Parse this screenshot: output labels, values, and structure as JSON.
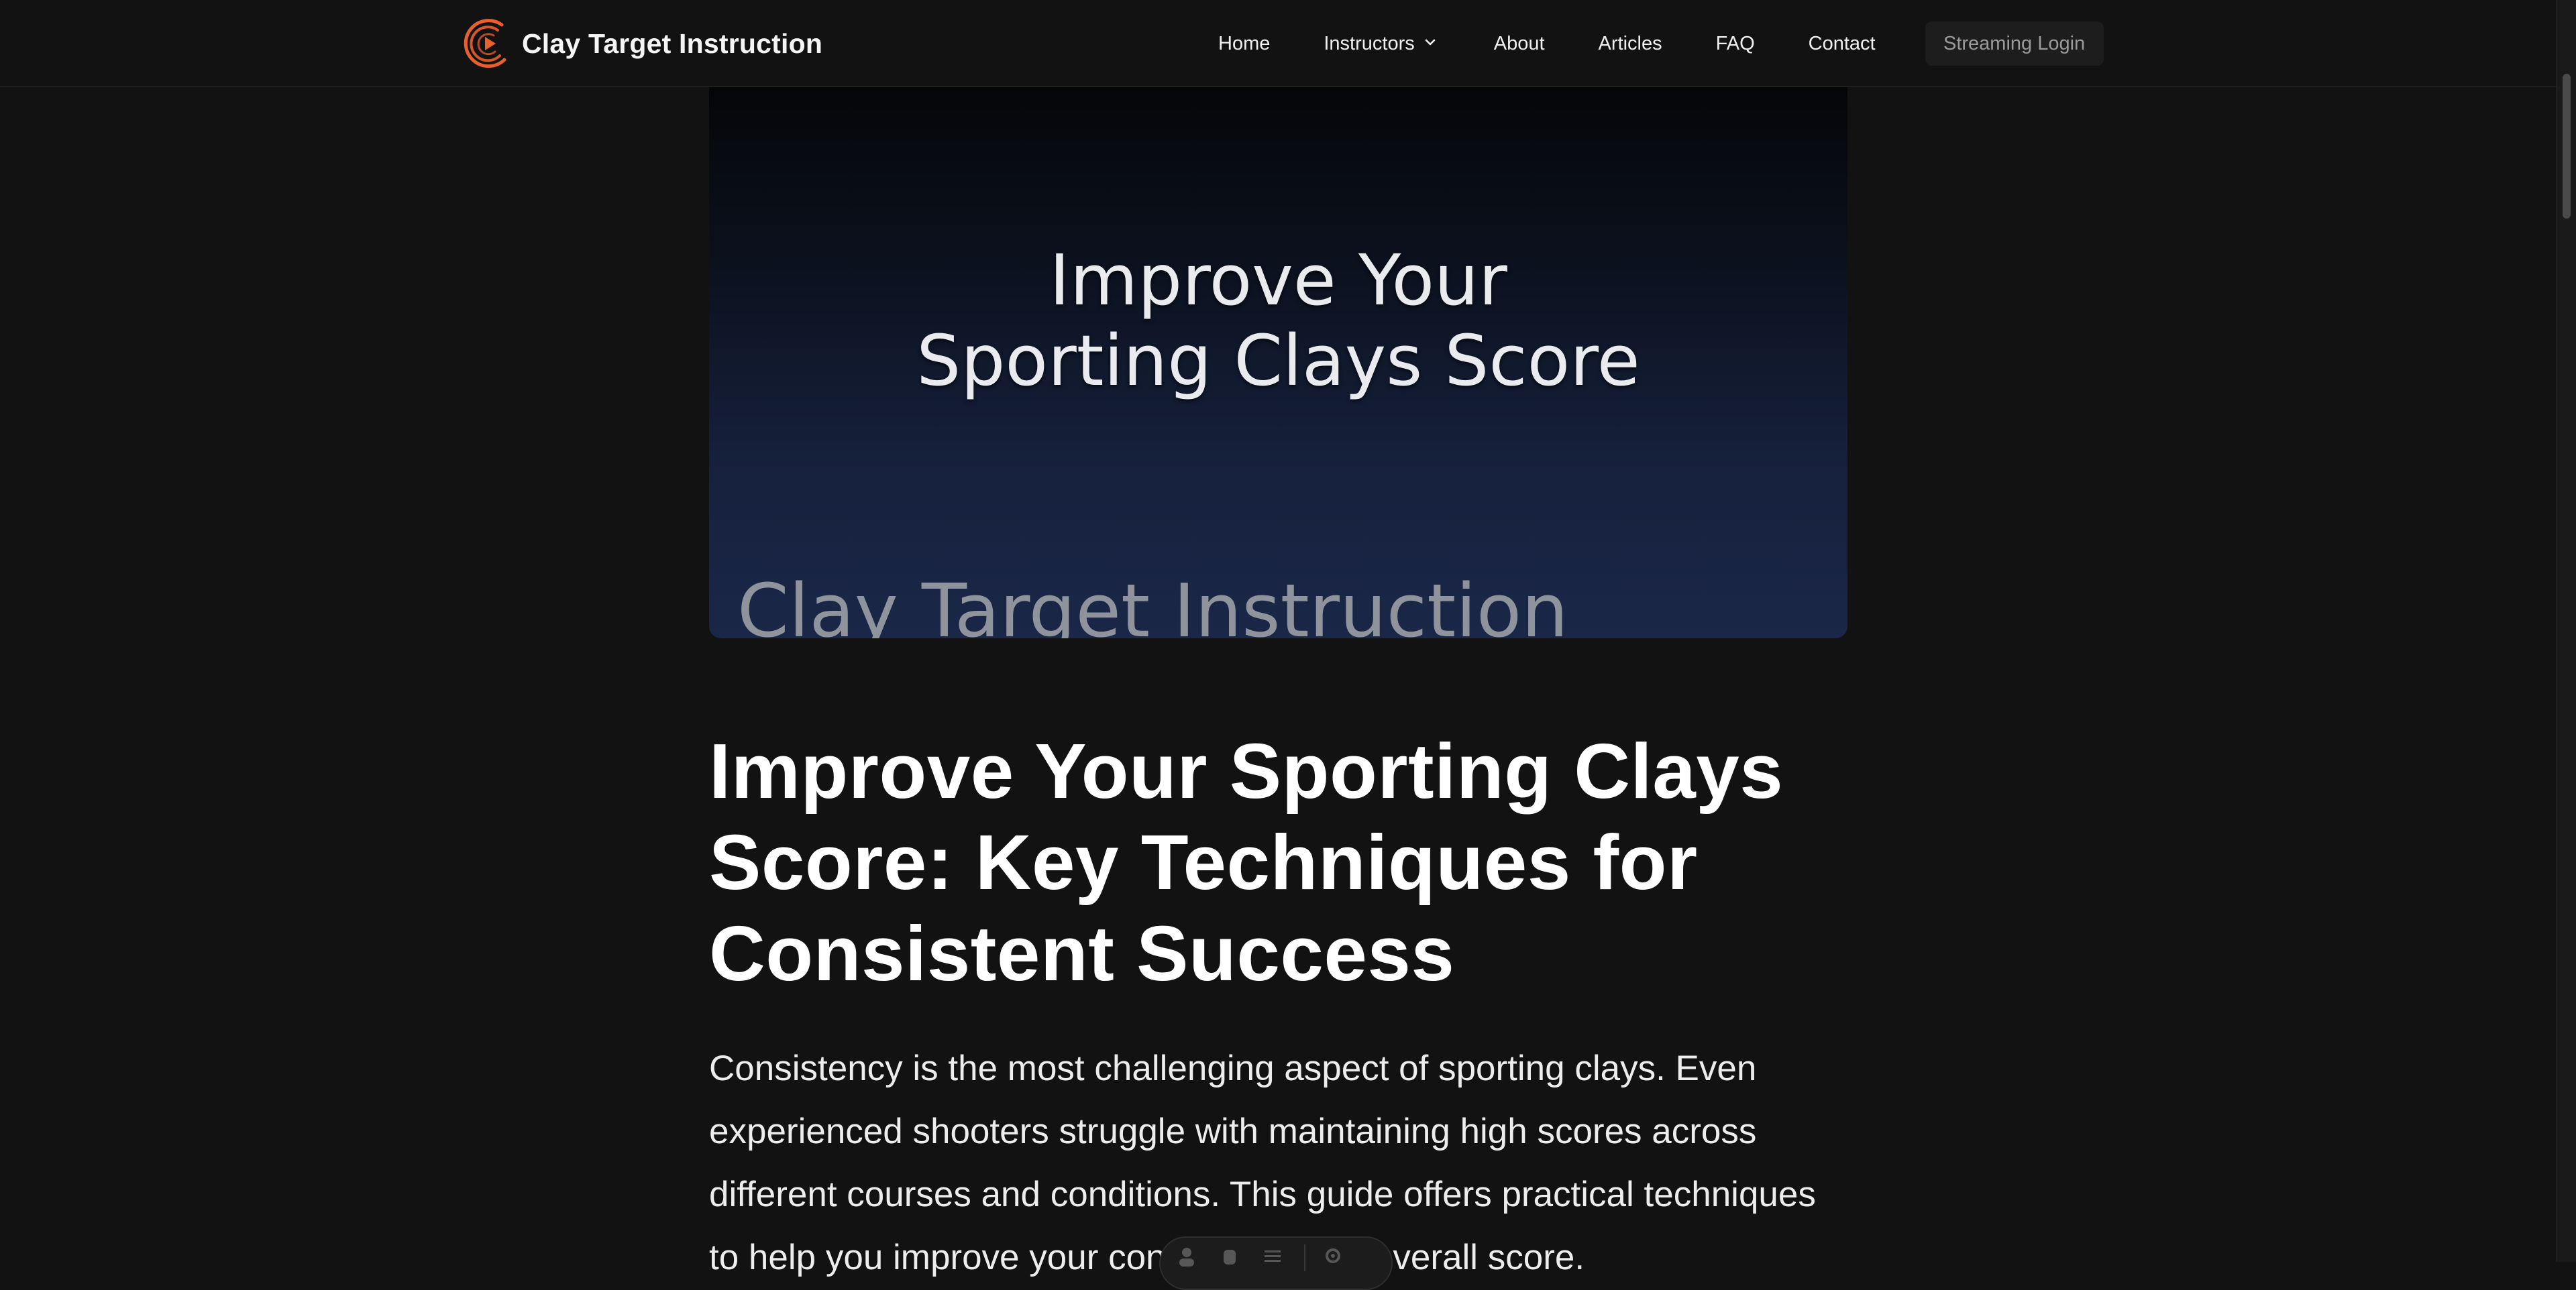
{
  "header": {
    "brand_name": "Clay Target Instruction",
    "nav": {
      "home": "Home",
      "instructors": "Instructors",
      "about": "About",
      "articles": "Articles",
      "faq": "FAQ",
      "contact": "Contact"
    },
    "login_label": "Streaming Login"
  },
  "hero": {
    "title_line1": "Improve Your",
    "title_line2": "Sporting Clays Score",
    "watermark": "Clay Target Instruction"
  },
  "article": {
    "title": "Improve Your Sporting Clays Score: Key Techniques for Consistent Success",
    "intro": "Consistency is the most challenging aspect of sporting clays. Even experienced shooters struggle with maintaining high scores across different courses and conditions. This guide offers practical techniques to help you improve your consistency and overall score."
  },
  "colors": {
    "background": "#121212",
    "accent": "#e8612c",
    "text": "#ffffff"
  },
  "icons": {
    "logo": "brand-logo-icon",
    "instructors_dropdown": "chevron-down-icon",
    "pill": [
      "user-icon",
      "hand-icon",
      "menu-icon",
      "settings-icon"
    ]
  }
}
